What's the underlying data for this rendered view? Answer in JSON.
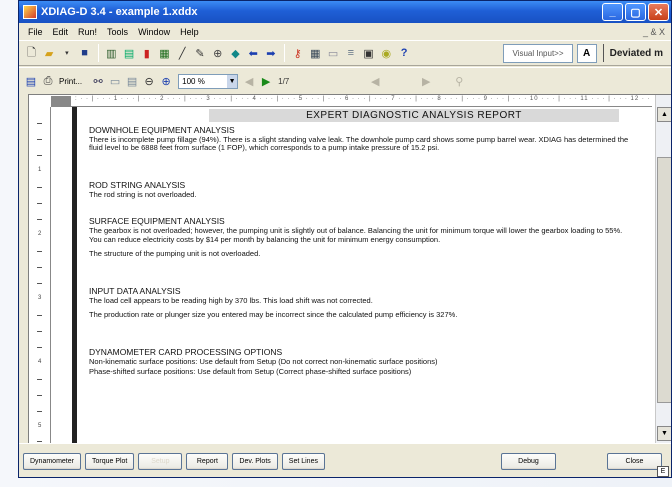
{
  "window": {
    "title": "XDIAG-D 3.4 - example 1.xddx"
  },
  "menubar": {
    "items": [
      "File",
      "Edit",
      "Run!",
      "Tools",
      "Window",
      "Help"
    ],
    "mdi_controls": "_ & X"
  },
  "toolbar": {
    "visual_input_label": "Visual Input>>",
    "font_label": "A",
    "mode_label": "Deviated m"
  },
  "preview_toolbar": {
    "print_label": "Print...",
    "zoom_value": "100 %",
    "page_indicator": "1/7"
  },
  "report": {
    "title": "EXPERT DIAGNOSTIC ANALYSIS REPORT",
    "sections": [
      {
        "heading": "DOWNHOLE EQUIPMENT ANALYSIS",
        "paragraphs": [
          "There is incomplete pump fillage (94%). There is a slight standing valve leak. The downhole pump card shows some pump barrel wear. XDIAG has determined the fluid level to be 6888 feet from surface (1 FOP), which corresponds to a pump intake pressure of 15.2 psi."
        ]
      },
      {
        "heading": "ROD STRING ANALYSIS",
        "paragraphs": [
          "The rod string is not overloaded."
        ]
      },
      {
        "heading": "SURFACE EQUIPMENT ANALYSIS",
        "paragraphs": [
          "The gearbox is not overloaded; however, the pumping unit is slightly out of balance. Balancing the unit for minimum torque will lower the gearbox loading to 55%. You can reduce electricity costs by $14 per month by balancing the unit for minimum energy consumption.",
          "The structure of the pumping unit is not overloaded."
        ]
      },
      {
        "heading": "INPUT DATA ANALYSIS",
        "paragraphs": [
          "The load cell appears to be reading high by 370 lbs. This load shift was not corrected.",
          "The production rate or plunger size you entered may be incorrect since the calculated pump efficiency is 327%."
        ]
      },
      {
        "heading": "DYNAMOMETER CARD PROCESSING OPTIONS",
        "paragraphs": [
          "Non-kinematic surface positions: Use default from Setup (Do not correct non-kinematic surface positions)",
          "Phase-shifted surface positions: Use default from Setup (Correct phase-shifted surface positions)"
        ]
      }
    ]
  },
  "bottom_bar": {
    "dynamometer": "Dynamometer",
    "torque_plot": "Torque Plot",
    "disabled_btn": "Setup",
    "report": "Report",
    "dev_plots": "Dev. Plots",
    "set_lines": "Set Lines",
    "debug": "Debug",
    "close": "Close",
    "status": "E"
  }
}
